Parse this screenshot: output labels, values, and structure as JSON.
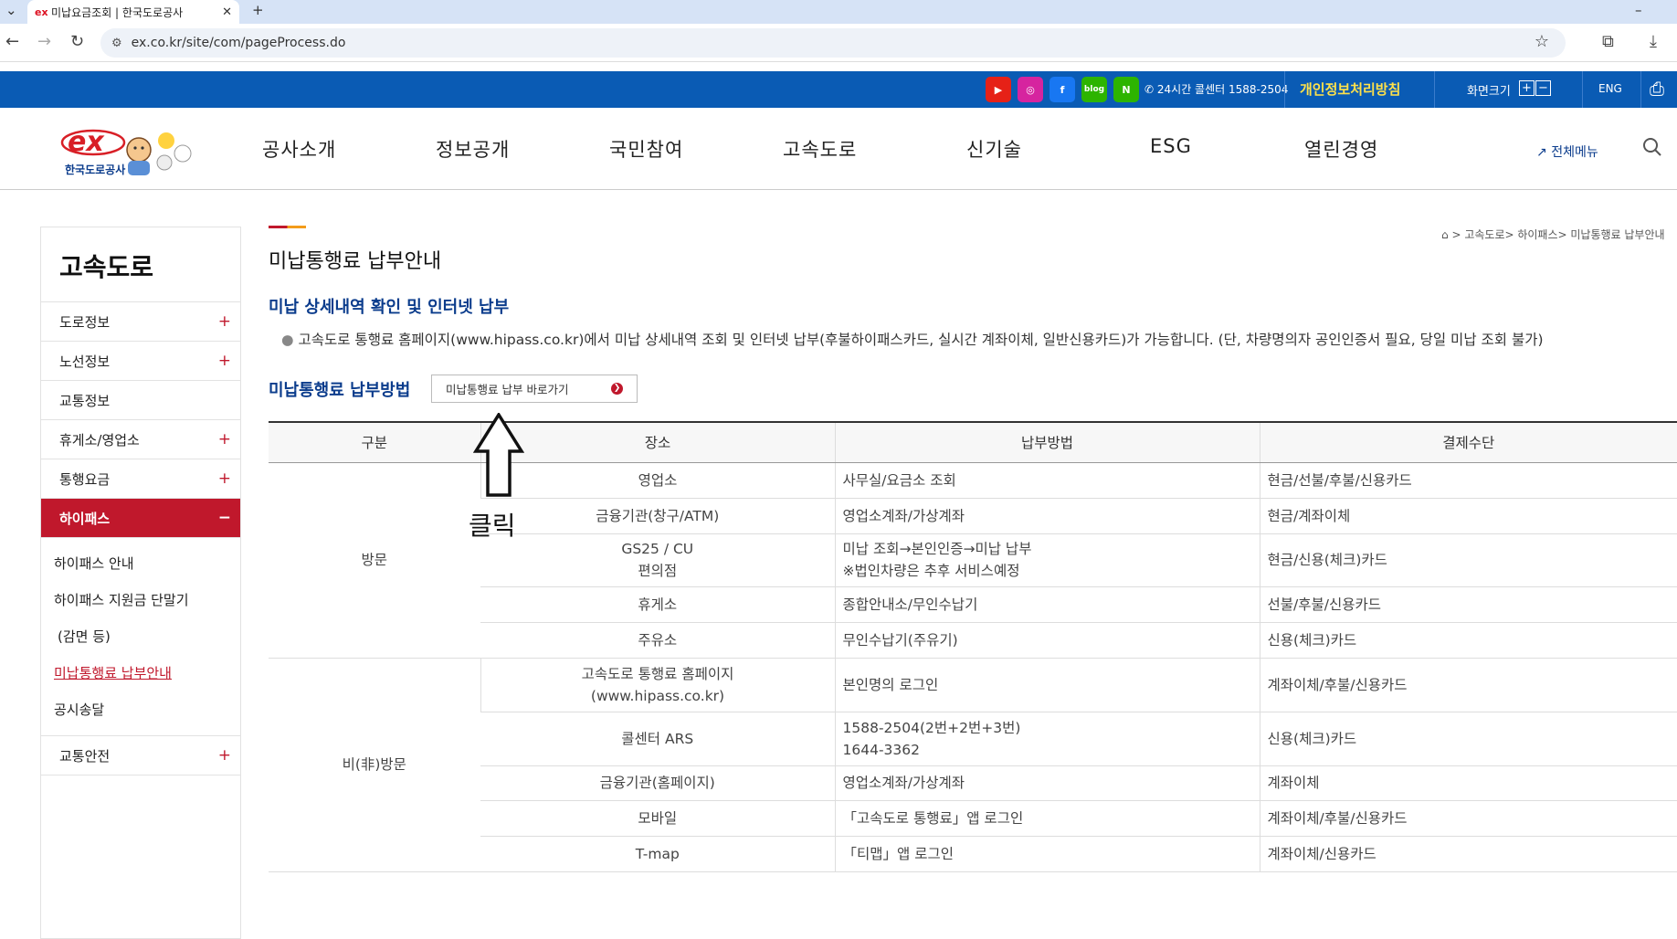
{
  "browser": {
    "tab_title": "미납요금조회 | 한국도로공사",
    "tab_favicon": "ex",
    "url": "ex.co.kr/site/com/pageProcess.do"
  },
  "utility_bar": {
    "sns": [
      {
        "name": "youtube",
        "label": "▶",
        "color": "#e62117"
      },
      {
        "name": "instagram",
        "label": "◎",
        "color": "#d6249f"
      },
      {
        "name": "facebook",
        "label": "f",
        "color": "#1877f2"
      },
      {
        "name": "blog",
        "label": "blog",
        "color": "#2db400"
      },
      {
        "name": "naver-post",
        "label": "N",
        "color": "#2db400"
      }
    ],
    "call_center": "24시간 콜센터 1588-2504",
    "privacy": "개인정보처리방침",
    "screen_size": "화면크기",
    "eng": "ENG"
  },
  "header": {
    "logo_text": "ex",
    "logo_sub": "한국도로공사",
    "gnb": [
      "공사소개",
      "정보공개",
      "국민참여",
      "고속도로",
      "신기술",
      "ESG",
      "열린경영"
    ],
    "all_menu": "전체메뉴"
  },
  "lnb": {
    "title": "고속도로",
    "items": [
      {
        "label": "도로정보",
        "toggle": "+"
      },
      {
        "label": "노선정보",
        "toggle": "+"
      },
      {
        "label": "교통정보",
        "toggle": ""
      },
      {
        "label": "휴게소/영업소",
        "toggle": "+"
      },
      {
        "label": "통행요금",
        "toggle": "+"
      },
      {
        "label": "하이패스",
        "toggle": "−"
      }
    ],
    "sub_items": [
      "하이패스 안내",
      "하이패스 지원금 단말기",
      "(감면 등)",
      "미납통행료 납부안내",
      "공시송달"
    ],
    "last_item": {
      "label": "교통안전",
      "toggle": "+"
    }
  },
  "breadcrumb": "> 고속도로> 하이패스> 미납통행료 납부안내",
  "page_title": "미납통행료 납부안내",
  "section_title": "미납 상세내역 확인 및 인터넷 납부",
  "description": "고속도로 통행료 홈페이지(www.hipass.co.kr)에서 미납 상세내역 조회 및 인터넷 납부(후불하이패스카드, 실시간 계좌이체, 일반신용카드)가 가능합니다. (단, 차량명의자 공인인증서 필요, 당일 미납 조회 불가)",
  "pay_section_title": "미납통행료 납부방법",
  "shortcut_button": "미납통행료 납부 바로가기",
  "annotation": {
    "label": "클릭"
  },
  "table": {
    "headers": [
      "구분",
      "장소",
      "납부방법",
      "결제수단"
    ],
    "visit_label": "방문",
    "nonvisit_label": "비(非)방문",
    "visit_rows": [
      {
        "place": "영업소",
        "method": "사무실/요금소 조회",
        "payment": "현금/선불/후불/신용카드"
      },
      {
        "place": "금융기관(창구/ATM)",
        "method": "영업소계좌/가상계좌",
        "payment": "현금/계좌이체"
      },
      {
        "place": "GS25 / CU",
        "place2": "편의점",
        "method": "미납 조회→본인인증→미납 납부",
        "method2": "※법인차량은 추후 서비스예정",
        "payment": "현금/신용(체크)카드"
      },
      {
        "place": "휴게소",
        "method": "종합안내소/무인수납기",
        "payment": "선불/후불/신용카드"
      },
      {
        "place": "주유소",
        "method": "무인수납기(주유기)",
        "payment": "신용(체크)카드"
      }
    ],
    "nonvisit_rows": [
      {
        "place": "고속도로 통행료 홈페이지",
        "place2": "(www.hipass.co.kr)",
        "method": "본인명의 로그인",
        "payment": "계좌이체/후불/신용카드"
      },
      {
        "place": "콜센터 ARS",
        "method": "1588-2504(2번+2번+3번)",
        "method2": "1644-3362",
        "payment": "신용(체크)카드"
      },
      {
        "place": "금융기관(홈페이지)",
        "method": "영업소계좌/가상계좌",
        "payment": "계좌이체"
      },
      {
        "place": "모바일",
        "method": "「고속도로 통행료」앱 로그인",
        "payment": "계좌이체/후불/신용카드"
      },
      {
        "place": "T-map",
        "method": "「티맵」앱 로그인",
        "payment": "계좌이체/신용카드"
      }
    ]
  }
}
